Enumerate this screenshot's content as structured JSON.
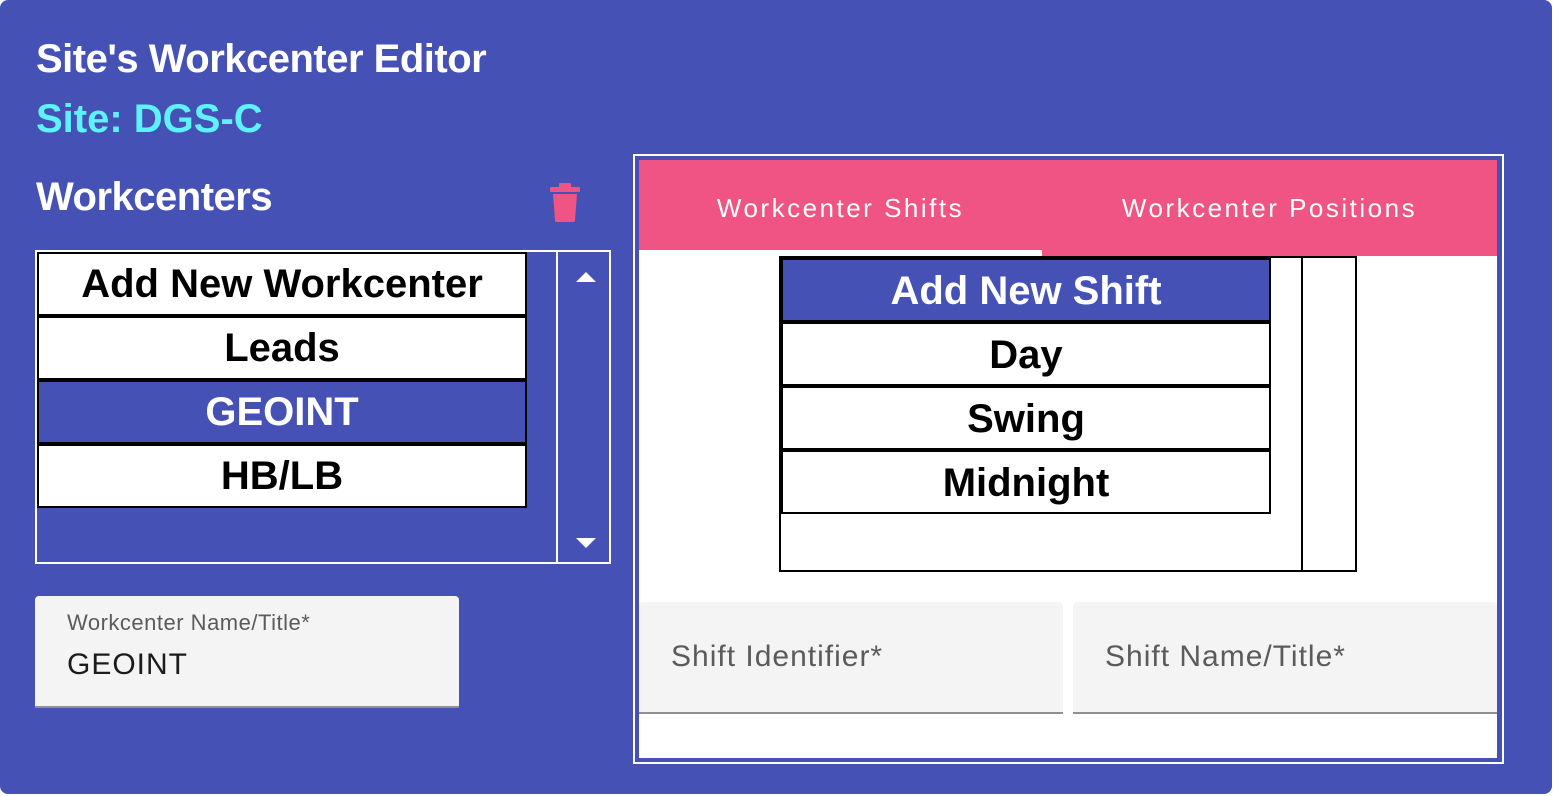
{
  "editor": {
    "title": "Site's Workcenter Editor",
    "site_label": "Site: DGS-C"
  },
  "workcenters": {
    "heading": "Workcenters",
    "delete_icon": "trash-icon",
    "items": [
      {
        "label": "Add New Workcenter",
        "selected": false
      },
      {
        "label": "Leads",
        "selected": false
      },
      {
        "label": "GEOINT",
        "selected": true
      },
      {
        "label": "HB/LB",
        "selected": false
      }
    ],
    "name_field": {
      "label": "Workcenter Name/Title*",
      "value": "GEOINT"
    }
  },
  "tabs": {
    "items": [
      {
        "label": "Workcenter Shifts",
        "active": true
      },
      {
        "label": "Workcenter Positions",
        "active": false
      }
    ]
  },
  "shifts": {
    "items": [
      {
        "label": "Add New Shift",
        "selected": true
      },
      {
        "label": "Day",
        "selected": false
      },
      {
        "label": "Swing",
        "selected": false
      },
      {
        "label": "Midnight",
        "selected": false
      }
    ],
    "identifier_field": {
      "placeholder": "Shift Identifier*",
      "value": ""
    },
    "name_field": {
      "placeholder": "Shift Name/Title*",
      "value": ""
    }
  },
  "colors": {
    "background": "#4651b5",
    "site_accent": "#5ef2ff",
    "tab_bar": "#f05484",
    "delete_icon": "#f05484"
  }
}
